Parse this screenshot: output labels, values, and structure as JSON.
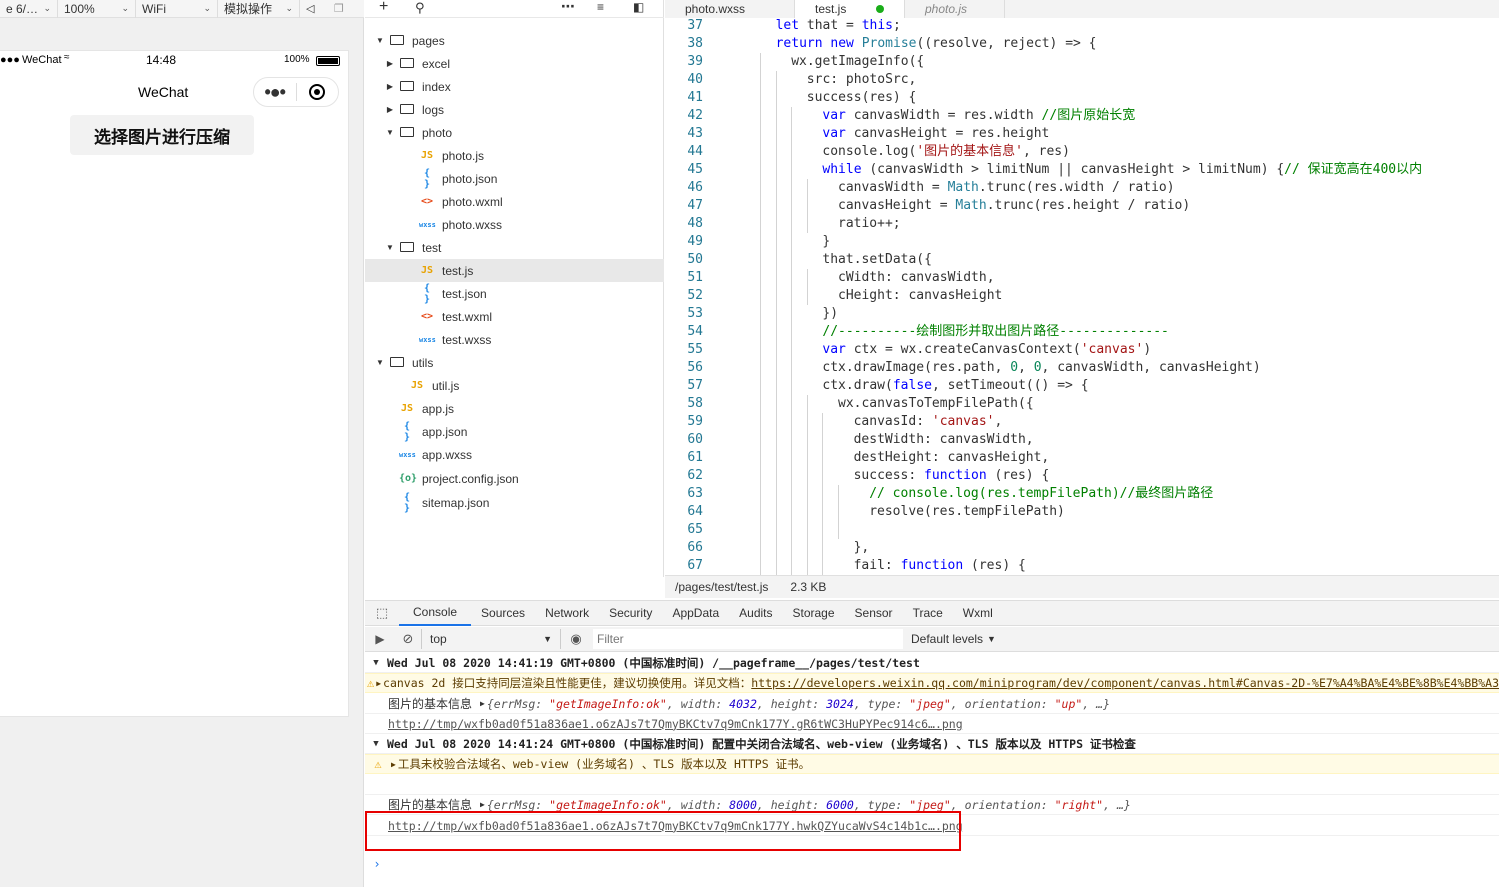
{
  "sim_toolbar": {
    "device": "e 6/…",
    "zoom": "100%",
    "network": "WiFi",
    "mode": "模拟操作"
  },
  "phone": {
    "carrier": "WeChat",
    "time": "14:48",
    "battery": "100%",
    "nav_title": "WeChat",
    "button_label": "选择图片进行压缩"
  },
  "explorer": {
    "items": [
      {
        "label": "pages",
        "type": "folder",
        "open": true,
        "depth": 0
      },
      {
        "label": "excel",
        "type": "folder",
        "open": false,
        "depth": 1
      },
      {
        "label": "index",
        "type": "folder",
        "open": false,
        "depth": 1
      },
      {
        "label": "logs",
        "type": "folder",
        "open": false,
        "depth": 1
      },
      {
        "label": "photo",
        "type": "folder",
        "open": true,
        "depth": 1
      },
      {
        "label": "photo.js",
        "type": "js",
        "depth": 2
      },
      {
        "label": "photo.json",
        "type": "json",
        "depth": 2
      },
      {
        "label": "photo.wxml",
        "type": "wxml",
        "depth": 2
      },
      {
        "label": "photo.wxss",
        "type": "wxss",
        "depth": 2
      },
      {
        "label": "test",
        "type": "folder",
        "open": true,
        "depth": 1
      },
      {
        "label": "test.js",
        "type": "js",
        "depth": 2,
        "active": true
      },
      {
        "label": "test.json",
        "type": "json",
        "depth": 2
      },
      {
        "label": "test.wxml",
        "type": "wxml",
        "depth": 2
      },
      {
        "label": "test.wxss",
        "type": "wxss",
        "depth": 2
      },
      {
        "label": "utils",
        "type": "folder",
        "open": true,
        "depth": 0
      },
      {
        "label": "util.js",
        "type": "js",
        "depth": 1
      },
      {
        "label": "app.js",
        "type": "js",
        "depth": 0
      },
      {
        "label": "app.json",
        "type": "json",
        "depth": 0
      },
      {
        "label": "app.wxss",
        "type": "wxss",
        "depth": 0
      },
      {
        "label": "project.config.json",
        "type": "config",
        "depth": 0
      },
      {
        "label": "sitemap.json",
        "type": "json",
        "depth": 0
      }
    ]
  },
  "editor": {
    "tabs": [
      {
        "label": "photo.wxss",
        "active": false,
        "italic": false
      },
      {
        "label": "test.js",
        "active": true,
        "modified": true,
        "italic": false
      },
      {
        "label": "photo.js",
        "active": false,
        "italic": true
      }
    ],
    "lines": [
      {
        "n": "37",
        "indent": 1,
        "html": "<span class=\"kw\">let</span> that = <span class=\"kw\">this</span>;"
      },
      {
        "n": "38",
        "indent": 1,
        "html": "<span class=\"kw\">return</span> <span class=\"kw\">new</span> <span class=\"fn\">Promise</span>((resolve, reject) => {"
      },
      {
        "n": "39",
        "indent": 2,
        "html": "wx.getImageInfo({"
      },
      {
        "n": "40",
        "indent": 3,
        "html": "src: photoSrc,"
      },
      {
        "n": "41",
        "indent": 3,
        "html": "success(res) {"
      },
      {
        "n": "42",
        "indent": 4,
        "html": "<span class=\"kw\">var</span> canvasWidth = res.width <span class=\"com\">//图片原始长宽</span>"
      },
      {
        "n": "43",
        "indent": 4,
        "html": "<span class=\"kw\">var</span> canvasHeight = res.height"
      },
      {
        "n": "44",
        "indent": 4,
        "html": "console.log(<span class=\"str\">'图片的基本信息'</span>, res)"
      },
      {
        "n": "45",
        "indent": 4,
        "html": "<span class=\"kw\">while</span> (canvasWidth > limitNum || canvasHeight > limitNum) {<span class=\"com\">// 保证宽高在400以内</span>"
      },
      {
        "n": "46",
        "indent": 5,
        "html": "canvasWidth = <span class=\"fn\">Math</span>.trunc(res.width / ratio)"
      },
      {
        "n": "47",
        "indent": 5,
        "html": "canvasHeight = <span class=\"fn\">Math</span>.trunc(res.height / ratio)"
      },
      {
        "n": "48",
        "indent": 5,
        "html": "ratio++;"
      },
      {
        "n": "49",
        "indent": 4,
        "html": "}"
      },
      {
        "n": "50",
        "indent": 4,
        "html": "that.setData({"
      },
      {
        "n": "51",
        "indent": 5,
        "html": "cWidth: canvasWidth,"
      },
      {
        "n": "52",
        "indent": 5,
        "html": "cHeight: canvasHeight"
      },
      {
        "n": "53",
        "indent": 4,
        "html": "})"
      },
      {
        "n": "54",
        "indent": 4,
        "html": "<span class=\"com\">//----------绘制图形并取出图片路径--------------</span>"
      },
      {
        "n": "55",
        "indent": 4,
        "html": "<span class=\"kw\">var</span> ctx = wx.createCanvasContext(<span class=\"str\">'canvas'</span>)"
      },
      {
        "n": "56",
        "indent": 4,
        "html": "ctx.drawImage(res.path, <span class=\"num\">0</span>, <span class=\"num\">0</span>, canvasWidth, canvasHeight)"
      },
      {
        "n": "57",
        "indent": 4,
        "html": "ctx.draw(<span class=\"kw\">false</span>, setTimeout(() => {"
      },
      {
        "n": "58",
        "indent": 5,
        "html": "wx.canvasToTempFilePath({"
      },
      {
        "n": "59",
        "indent": 6,
        "html": "canvasId: <span class=\"str\">'canvas'</span>,"
      },
      {
        "n": "60",
        "indent": 6,
        "html": "destWidth: canvasWidth,"
      },
      {
        "n": "61",
        "indent": 6,
        "html": "destHeight: canvasHeight,"
      },
      {
        "n": "62",
        "indent": 6,
        "html": "success: <span class=\"kw\">function</span> (res) {"
      },
      {
        "n": "63",
        "indent": 7,
        "html": "<span class=\"com\">// console.log(res.tempFilePath)//最终图片路径</span>"
      },
      {
        "n": "64",
        "indent": 7,
        "html": "resolve(res.tempFilePath)"
      },
      {
        "n": "65",
        "indent": 7,
        "html": ""
      },
      {
        "n": "66",
        "indent": 6,
        "html": "},"
      },
      {
        "n": "67",
        "indent": 6,
        "html": "fail: <span class=\"kw\">function</span> (res) {"
      }
    ],
    "status_path": "/pages/test/test.js",
    "status_size": "2.3 KB"
  },
  "devtools": {
    "tabs": [
      "Console",
      "Sources",
      "Network",
      "Security",
      "AppData",
      "Audits",
      "Storage",
      "Sensor",
      "Trace",
      "Wxml"
    ],
    "context": "top",
    "filter_placeholder": "Filter",
    "levels": "Default levels",
    "group1": "Wed Jul 08 2020 14:41:19 GMT+0800 (中国标准时间) /__pageframe__/pages/test/test",
    "warn1_text": "canvas 2d 接口支持同层渲染且性能更佳，建议切换使用。详见文档：",
    "warn1_link": "https://developers.weixin.qq.com/miniprogram/dev/component/canvas.html#Canvas-2D-%E7%A4%BA%E4%BE%8B%E4%BB%A3",
    "log1_label": "图片的基本信息",
    "log1_obj": "{errMsg: \"getImageInfo:ok\", width: 4032, height: 3024, type: \"jpeg\", orientation: \"up\", …}",
    "log1_url": "http://tmp/wxfb0ad0f51a836ae1.o6zAJs7t7QmyBKCtv7q9mCnk177Y.gR6tWC3HuPYPec914c6….png",
    "group2": "Wed Jul 08 2020 14:41:24 GMT+0800 (中国标准时间) 配置中关闭合法域名、web-view (业务域名) 、TLS 版本以及 HTTPS 证书检查",
    "warn2_text": "工具未校验合法域名、web-view (业务域名) 、TLS 版本以及 HTTPS 证书。",
    "log2_label": "图片的基本信息",
    "log2_obj": "{errMsg: \"getImageInfo:ok\", width: 8000, height: 6000, type: \"jpeg\", orientation: \"right\", …}",
    "log2_url": "http://tmp/wxfb0ad0f51a836ae1.o6zAJs7t7QmyBKCtv7q9mCnk177Y.hwkQZYucaWvS4c14b1c….png"
  }
}
